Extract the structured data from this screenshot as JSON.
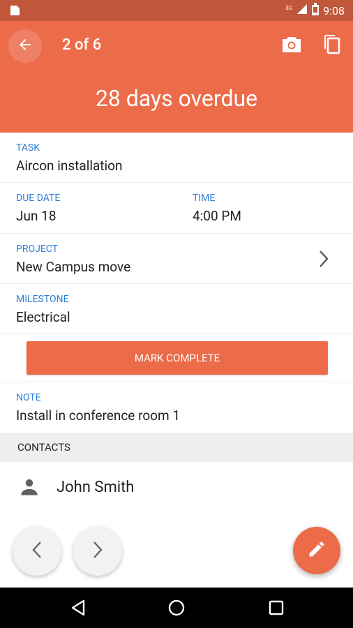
{
  "status_bar": {
    "time": "9:08",
    "signal_label": "3G",
    "icons": [
      "notification-icon",
      "signal-icon",
      "battery-icon"
    ]
  },
  "header": {
    "counter": "2 of 6",
    "overdue_text": "28 days overdue",
    "color": "#ec6c4a",
    "icons": [
      "back-arrow-icon",
      "camera-icon",
      "copy-icon"
    ]
  },
  "task": {
    "label": "TASK",
    "value": "Aircon installation"
  },
  "due_date": {
    "label": "DUE DATE",
    "value": "Jun 18"
  },
  "time": {
    "label": "TIME",
    "value": "4:00 PM"
  },
  "project": {
    "label": "PROJECT",
    "value": "New Campus move"
  },
  "milestone": {
    "label": "MILESTONE",
    "value": "Electrical"
  },
  "mark_complete": {
    "label": "MARK COMPLETE"
  },
  "note": {
    "label": "NOTE",
    "value": "Install in conference room 1"
  },
  "contacts": {
    "header": "CONTACTS",
    "items": [
      {
        "name": "John Smith",
        "icon": "person-icon"
      }
    ]
  },
  "bottom_actions": {
    "icons": [
      "chevron-left-icon",
      "chevron-right-icon",
      "edit-pencil-icon"
    ]
  },
  "system_nav": {
    "icons": [
      "back-triangle-icon",
      "home-circle-icon",
      "recents-square-icon"
    ]
  },
  "label_color": "#2f7ed8"
}
